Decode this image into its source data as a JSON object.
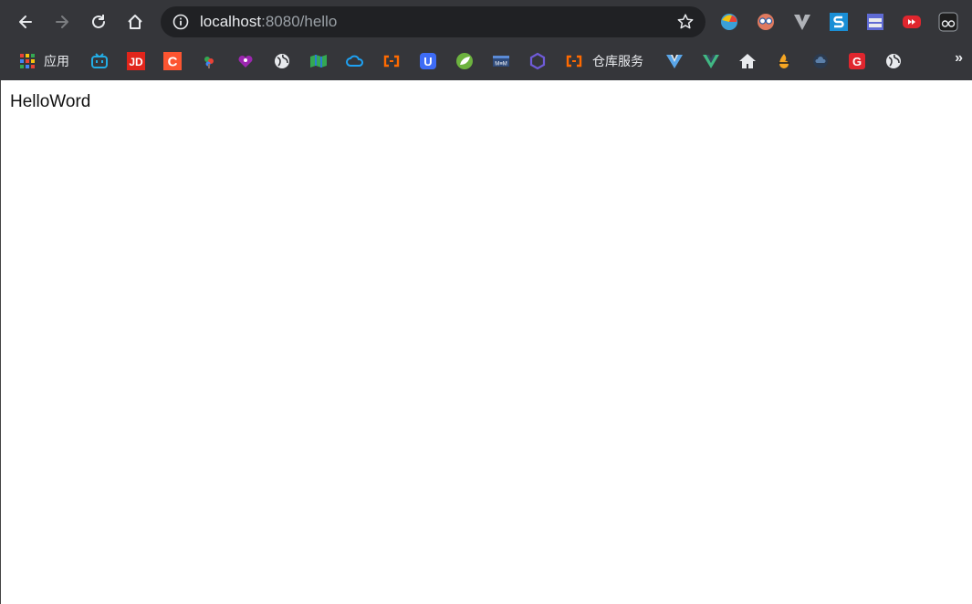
{
  "browser": {
    "url_host": "localhost",
    "url_rest": ":8080/hello",
    "toolbar_icons": [
      "back-arrow-icon",
      "forward-arrow-icon",
      "reload-icon",
      "home-icon",
      "info-icon",
      "star-icon"
    ],
    "extensions": [
      "ext-colorful-icon",
      "ext-face-icon",
      "ext-v-icon",
      "ext-s-icon",
      "ext-window-icon",
      "ext-red-play-icon",
      "ext-glasses-icon"
    ]
  },
  "bookmarks": {
    "apps_label": "应用",
    "warehouse_label": "仓库服务",
    "overflow": "»",
    "icons": [
      "apps-grid-icon",
      "bilibili-icon",
      "jd-icon",
      "c-icon",
      "tree-icon",
      "heart-icon",
      "globe-icon",
      "map-icon",
      "cloud-icon",
      "bracket-icon",
      "u-icon",
      "spring-icon",
      "mm-icon",
      "hexagon-icon",
      "bracket-icon",
      "v-icon",
      "vue-icon",
      "house-icon",
      "flame-icon",
      "cloud-dark-icon",
      "g-icon",
      "globe-icon"
    ]
  },
  "page": {
    "text": "HelloWord"
  },
  "colors": {
    "chrome_bg": "#35363a",
    "omnibox_bg": "#202124",
    "page_bg": "#ffffff"
  }
}
